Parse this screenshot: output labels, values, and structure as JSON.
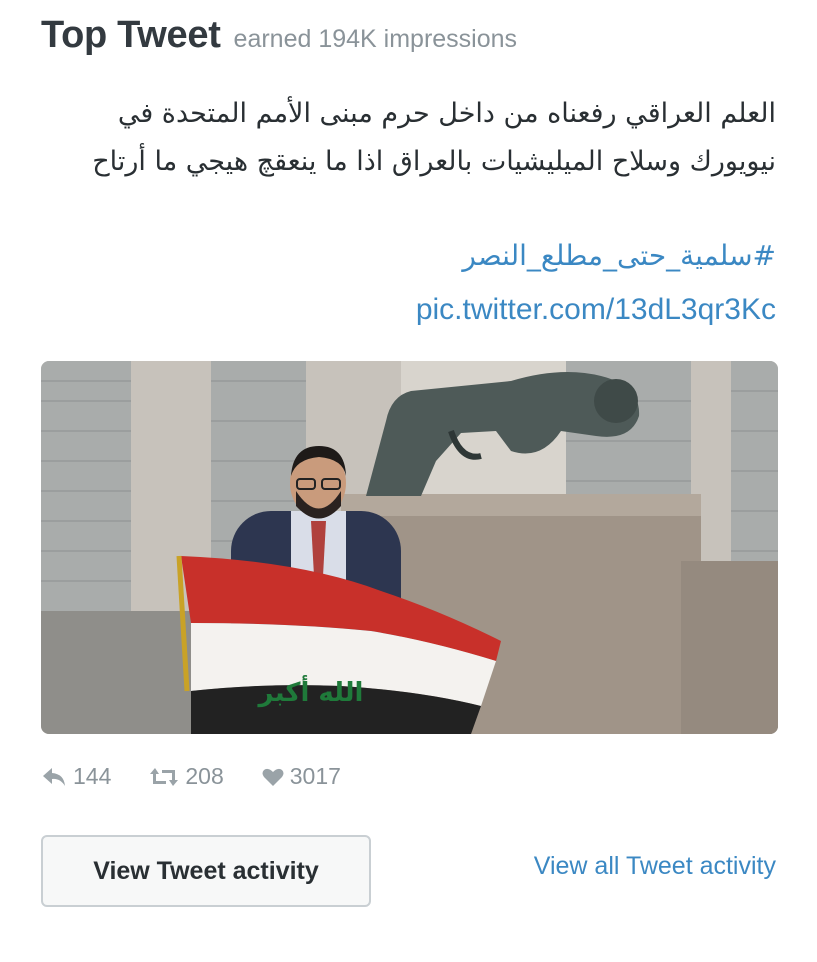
{
  "header": {
    "title": "Top Tweet",
    "subtitle": "earned 194K impressions"
  },
  "tweet": {
    "text": "العلم العراقي رفعناه من داخل حرم مبنى الأمم المتحدة في نيويورك وسلاح الميليشيات بالعراق اذا ما ينعقچ هيجي ما أرتاح",
    "hashtag": "#سلمية_حتى_مطلع_النصر",
    "pic_link": "pic.twitter.com/13dL3qr3Kc",
    "flag_text": "الله أكبر"
  },
  "stats": {
    "replies": "144",
    "retweets": "208",
    "likes": "3017"
  },
  "buttons": {
    "view_activity": "View Tweet activity",
    "view_all": "View all Tweet activity"
  },
  "colors": {
    "link": "#3b88c3",
    "muted": "#8a9399"
  }
}
